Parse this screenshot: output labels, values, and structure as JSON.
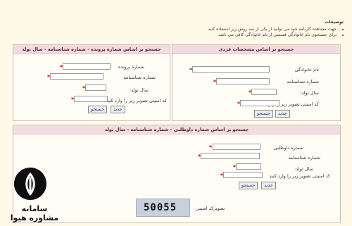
{
  "notes": {
    "title": "توضیحات",
    "items": [
      "جهت مشاهده کارنامه خود می توانید از یکی از سه روش زیر استفاده کنید",
      "برای جستجوی نام خانوادگی قسمتی از نام خانوادگی کافی می باشد"
    ]
  },
  "panel_personal": {
    "title": "جستجو بر اساس مشخصات فردی",
    "last_name_label": "نام خانوادگی",
    "id_label": "شماره شناسنامه",
    "birth_year_label": "سال تولد:",
    "captcha_label": "کد امنیتی تصویر زیر را وارد کنید",
    "search_label": "جستجو",
    "new_label": "جدید"
  },
  "panel_file": {
    "title": "جستجو بر اساس شماره پرونده - شماره شناسنامه - سال تولد",
    "file_label": "شماره پرونده",
    "id_label": "شماره شناسنامه",
    "birth_year_label": "سال تولد:",
    "captcha_label": "کد امنیتی تصویر زیر را وارد کنید",
    "search_label": "جستجو",
    "new_label": "جدید"
  },
  "panel_volunteer": {
    "title": "جستجو بر اساس شماره داوطلبی - شماره شناسنامه - سال تولد",
    "volunteer_label": "شماره داوطلبی",
    "id_label": "شماره شناسنامه",
    "birth_year_label": "سال تولد:",
    "captcha_label": "کد امنیتی تصویر زیر را وارد کنید",
    "search_label": "جستجو",
    "new_label": "جدید"
  },
  "captcha": {
    "code": "50055",
    "label": "تصویرکد امنیتی"
  },
  "watermark": {
    "text": "سامانه مشاوره هیوا"
  }
}
